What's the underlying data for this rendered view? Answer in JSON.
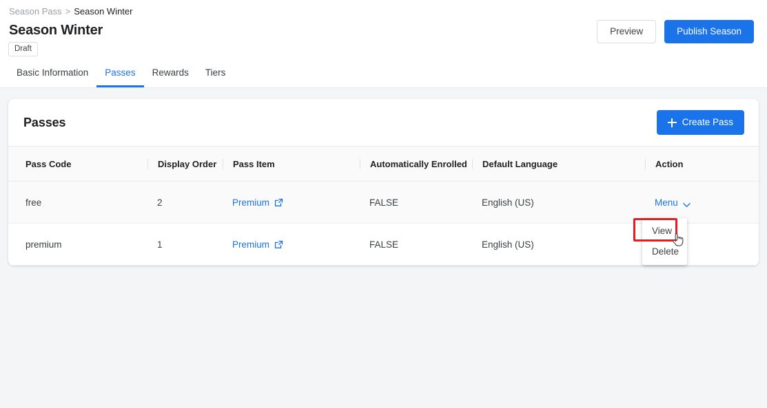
{
  "breadcrumb": {
    "parent": "Season Pass",
    "separator": ">",
    "current": "Season Winter"
  },
  "header": {
    "title": "Season Winter",
    "status": "Draft",
    "preview_label": "Preview",
    "publish_label": "Publish Season"
  },
  "tabs": [
    {
      "label": "Basic Information",
      "active": false
    },
    {
      "label": "Passes",
      "active": true
    },
    {
      "label": "Rewards",
      "active": false
    },
    {
      "label": "Tiers",
      "active": false
    }
  ],
  "card": {
    "title": "Passes",
    "create_label": "Create Pass",
    "create_icon": "plus-icon"
  },
  "table": {
    "columns": [
      "Pass Code",
      "Display Order",
      "Pass Item",
      "Automatically Enrolled",
      "Default Language",
      "Action"
    ],
    "rows": [
      {
        "pass_code": "free",
        "display_order": "2",
        "pass_item": "Premium",
        "pass_item_icon": "external-link-icon",
        "automatically_enrolled": "FALSE",
        "default_language": "English (US)",
        "action": "Menu",
        "action_icon": "chevron-down-icon"
      },
      {
        "pass_code": "premium",
        "display_order": "1",
        "pass_item": "Premium",
        "pass_item_icon": "external-link-icon",
        "automatically_enrolled": "FALSE",
        "default_language": "English (US)",
        "action": "",
        "action_icon": ""
      }
    ]
  },
  "dropdown": {
    "items": [
      {
        "label": "View"
      },
      {
        "label": "Delete"
      }
    ]
  },
  "colors": {
    "accent": "#1a73e8",
    "page_background": "#f4f5f7",
    "annotation": "#e02020",
    "text_primary": "#202124",
    "text_muted": "#9aa0a6"
  }
}
